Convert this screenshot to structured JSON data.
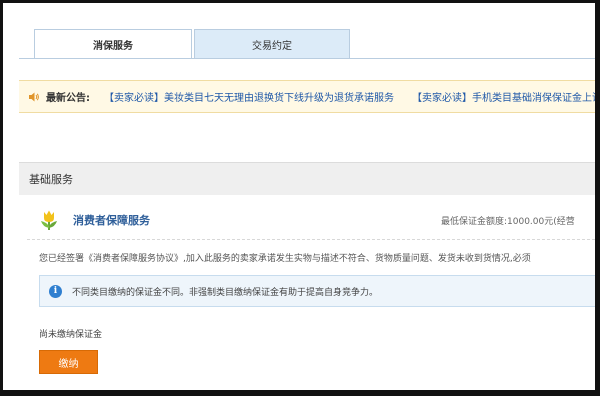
{
  "tabs": [
    {
      "label": "消保服务",
      "active": true
    },
    {
      "label": "交易约定",
      "active": false
    }
  ],
  "notice": {
    "label": "最新公告:",
    "items": [
      "【卖家必读】美妆类目七天无理由退换货下线升级为退货承诺服务",
      "【卖家必读】手机类目基础消保保证金上调"
    ]
  },
  "section": {
    "title": "基础服务"
  },
  "service": {
    "icon": "tulip-icon",
    "title": "消费者保障服务",
    "min_deposit": "最低保证金额度:1000.00元(经营",
    "agreement_text": "您已经签署《消费者保障服务协议》,加入此服务的卖家承诺发生实物与描述不符合、货物质量问题、发货未收到货情况,必须",
    "info_text": "不同类目缴纳的保证金不同。非强制类目缴纳保证金有助于提高自身竞争力。",
    "status_text": "尚未缴纳保证金",
    "pay_button": "缴纳"
  },
  "colors": {
    "link": "#1f58a8",
    "button": "#ee7a12",
    "notice_bg": "#fff9e5",
    "tab_inactive_bg": "#dcebf8",
    "info_bg": "#eef5fb"
  }
}
